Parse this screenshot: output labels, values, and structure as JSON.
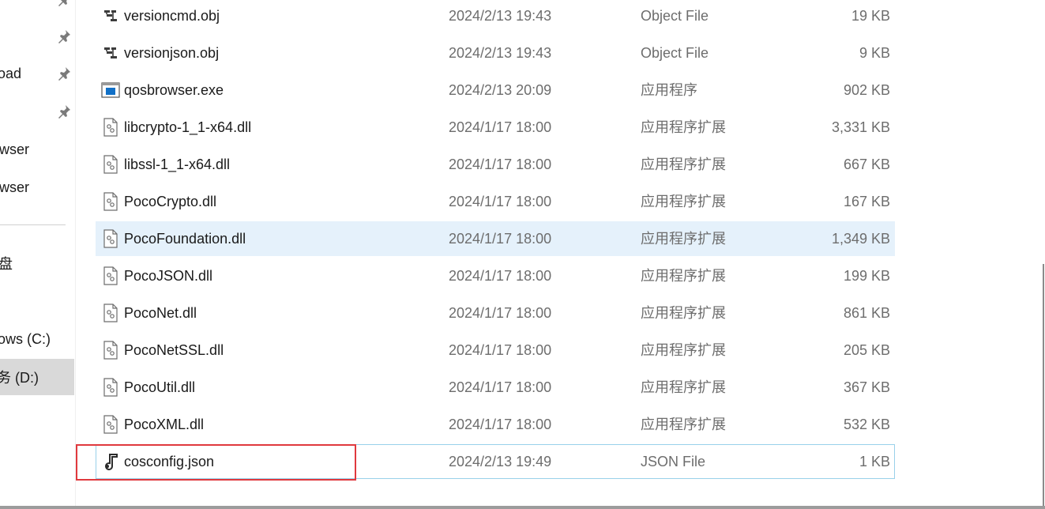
{
  "sidebar": {
    "items": [
      {
        "label": "oad",
        "pinned": true
      },
      {
        "label": "wser",
        "pinned": false
      },
      {
        "label": "wser",
        "pinned": false
      },
      {
        "label": "盘",
        "pinned": false
      },
      {
        "label": "ows (C:)",
        "pinned": false
      },
      {
        "label": "务 (D:)",
        "pinned": false,
        "selected": true
      }
    ]
  },
  "files": [
    {
      "name": "versioncmd.obj",
      "date": "2024/2/13 19:43",
      "type": "Object File",
      "size": "19 KB",
      "icon": "object-file-icon"
    },
    {
      "name": "versionjson.obj",
      "date": "2024/2/13 19:43",
      "type": "Object File",
      "size": "9 KB",
      "icon": "object-file-icon"
    },
    {
      "name": "qosbrowser.exe",
      "date": "2024/2/13 20:09",
      "type": "应用程序",
      "size": "902 KB",
      "icon": "exe-icon"
    },
    {
      "name": "libcrypto-1_1-x64.dll",
      "date": "2024/1/17 18:00",
      "type": "应用程序扩展",
      "size": "3,331 KB",
      "icon": "dll-icon"
    },
    {
      "name": "libssl-1_1-x64.dll",
      "date": "2024/1/17 18:00",
      "type": "应用程序扩展",
      "size": "667 KB",
      "icon": "dll-icon"
    },
    {
      "name": "PocoCrypto.dll",
      "date": "2024/1/17 18:00",
      "type": "应用程序扩展",
      "size": "167 KB",
      "icon": "dll-icon"
    },
    {
      "name": "PocoFoundation.dll",
      "date": "2024/1/17 18:00",
      "type": "应用程序扩展",
      "size": "1,349 KB",
      "icon": "dll-icon"
    },
    {
      "name": "PocoJSON.dll",
      "date": "2024/1/17 18:00",
      "type": "应用程序扩展",
      "size": "199 KB",
      "icon": "dll-icon"
    },
    {
      "name": "PocoNet.dll",
      "date": "2024/1/17 18:00",
      "type": "应用程序扩展",
      "size": "861 KB",
      "icon": "dll-icon"
    },
    {
      "name": "PocoNetSSL.dll",
      "date": "2024/1/17 18:00",
      "type": "应用程序扩展",
      "size": "205 KB",
      "icon": "dll-icon"
    },
    {
      "name": "PocoUtil.dll",
      "date": "2024/1/17 18:00",
      "type": "应用程序扩展",
      "size": "367 KB",
      "icon": "dll-icon"
    },
    {
      "name": "PocoXML.dll",
      "date": "2024/1/17 18:00",
      "type": "应用程序扩展",
      "size": "532 KB",
      "icon": "dll-icon"
    },
    {
      "name": "cosconfig.json",
      "date": "2024/2/13 19:49",
      "type": "JSON File",
      "size": "1 KB",
      "icon": "json-file-icon"
    }
  ],
  "colors": {
    "hover_row": "#e5f1fb",
    "focus_border": "#99d1ea",
    "highlight_box": "#e0393e",
    "selected_nav": "#d9d9d9"
  }
}
